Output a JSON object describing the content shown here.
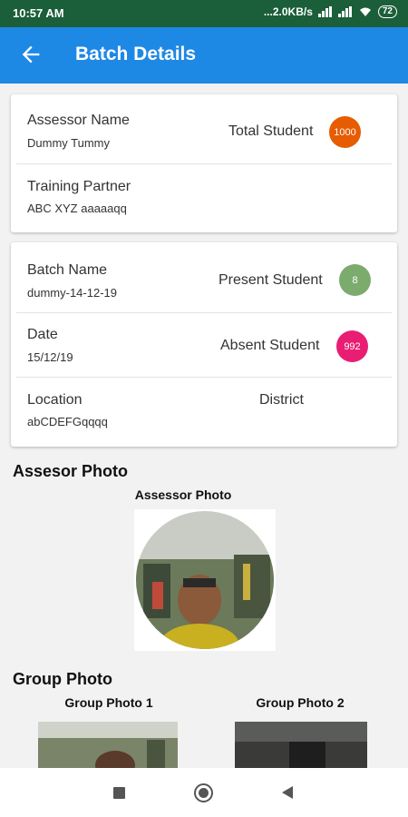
{
  "status": {
    "time": "10:57 AM",
    "speed": "...2.0KB/s",
    "battery": "72"
  },
  "appbar": {
    "title": "Batch Details",
    "back_icon": "arrow-left-icon"
  },
  "card1": {
    "assessor_label": "Assessor Name",
    "assessor_value": "Dummy Tummy",
    "total_label": "Total Student",
    "total_value": "1000",
    "partner_label": "Training Partner",
    "partner_value": "ABC XYZ aaaaaqq"
  },
  "card2": {
    "batch_label": "Batch Name",
    "batch_value": "dummy-14-12-19",
    "present_label": "Present Student",
    "present_value": "8",
    "date_label": "Date",
    "date_value": "15/12/19",
    "absent_label": "Absent Student",
    "absent_value": "992",
    "location_label": "Location",
    "location_value": "abCDEFGqqqq",
    "district_label": "District"
  },
  "assessor_section": {
    "title": "Assesor Photo",
    "caption": "Assessor Photo"
  },
  "group_section": {
    "title": "Group Photo",
    "photo1_caption": "Group Photo 1",
    "photo2_caption": "Group Photo 2"
  },
  "colors": {
    "statusbar": "#1b5e3a",
    "appbar": "#1e88e5",
    "badge_total": "#e65c00",
    "badge_present": "#7cab6e",
    "badge_absent": "#e91e73"
  }
}
